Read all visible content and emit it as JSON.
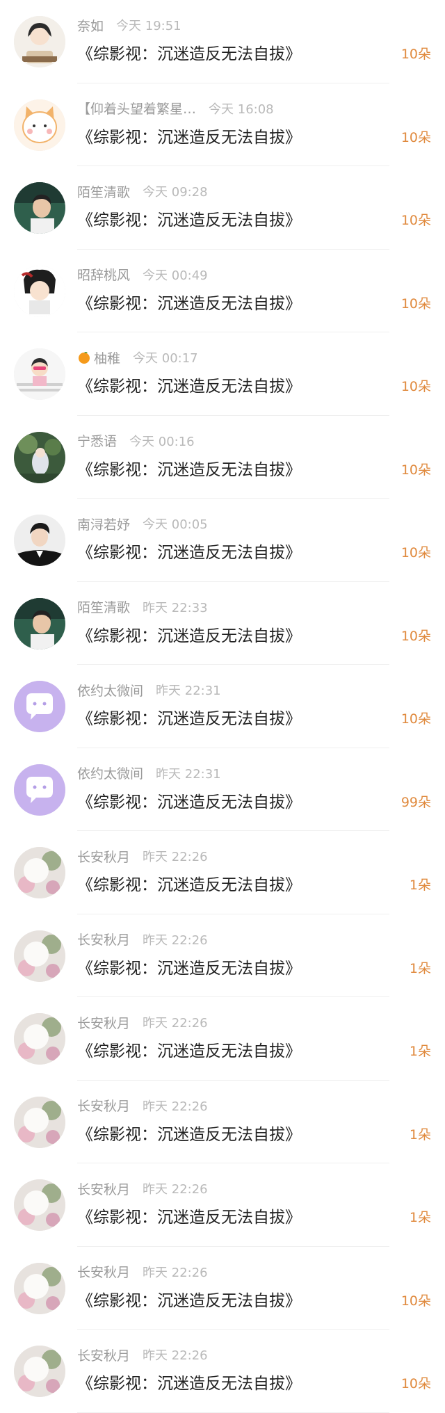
{
  "colors": {
    "accent": "#e08a3e",
    "name": "#9b9b9b",
    "time": "#b9b9b9",
    "title": "#222222"
  },
  "items": [
    {
      "name": "奈如",
      "time": "今天 19:51",
      "title": "《综影视：沉迷造反无法自拔》",
      "gift": "10朵",
      "avatar": "anime-girl-avatar"
    },
    {
      "name": "【仰着头望着繁星…",
      "time": "今天 16:08",
      "title": "《综影视：沉迷造反无法自拔》",
      "gift": "10朵",
      "avatar": "cat-cartoon-avatar"
    },
    {
      "name": "陌笙清歌",
      "time": "今天 09:28",
      "title": "《综影视：沉迷造反无法自拔》",
      "gift": "10朵",
      "avatar": "man-photo-avatar"
    },
    {
      "name": "昭辞桃风",
      "time": "今天 00:49",
      "title": "《综影视：沉迷造反无法自拔》",
      "gift": "10朵",
      "avatar": "chibi-character-avatar"
    },
    {
      "name": "柚稚",
      "time": "今天 00:17",
      "title": "《综影视：沉迷造反无法自拔》",
      "gift": "10朵",
      "avatar": "cartoon-boy-avatar",
      "name_icon": "orange-icon"
    },
    {
      "name": "宁悉语",
      "time": "今天 00:16",
      "title": "《综影视：沉迷造反无法自拔》",
      "gift": "10朵",
      "avatar": "painting-avatar"
    },
    {
      "name": "南浔若妤",
      "time": "今天 00:05",
      "title": "《综影视：沉迷造反无法自拔》",
      "gift": "10朵",
      "avatar": "man-suit-avatar"
    },
    {
      "name": "陌笙清歌",
      "time": "昨天 22:33",
      "title": "《综影视：沉迷造反无法自拔》",
      "gift": "10朵",
      "avatar": "man-photo-avatar"
    },
    {
      "name": "依约太微间",
      "time": "昨天 22:31",
      "title": "《综影视：沉迷造反无法自拔》",
      "gift": "10朵",
      "avatar": "purple-chat-avatar"
    },
    {
      "name": "依约太微间",
      "time": "昨天 22:31",
      "title": "《综影视：沉迷造反无法自拔》",
      "gift": "99朵",
      "avatar": "purple-chat-avatar"
    },
    {
      "name": "长安秋月",
      "time": "昨天 22:26",
      "title": "《综影视：沉迷造反无法自拔》",
      "gift": "1朵",
      "avatar": "moon-flower-avatar"
    },
    {
      "name": "长安秋月",
      "time": "昨天 22:26",
      "title": "《综影视：沉迷造反无法自拔》",
      "gift": "1朵",
      "avatar": "moon-flower-avatar"
    },
    {
      "name": "长安秋月",
      "time": "昨天 22:26",
      "title": "《综影视：沉迷造反无法自拔》",
      "gift": "1朵",
      "avatar": "moon-flower-avatar"
    },
    {
      "name": "长安秋月",
      "time": "昨天 22:26",
      "title": "《综影视：沉迷造反无法自拔》",
      "gift": "1朵",
      "avatar": "moon-flower-avatar"
    },
    {
      "name": "长安秋月",
      "time": "昨天 22:26",
      "title": "《综影视：沉迷造反无法自拔》",
      "gift": "1朵",
      "avatar": "moon-flower-avatar"
    },
    {
      "name": "长安秋月",
      "time": "昨天 22:26",
      "title": "《综影视：沉迷造反无法自拔》",
      "gift": "10朵",
      "avatar": "moon-flower-avatar"
    },
    {
      "name": "长安秋月",
      "time": "昨天 22:26",
      "title": "《综影视：沉迷造反无法自拔》",
      "gift": "10朵",
      "avatar": "moon-flower-avatar"
    }
  ]
}
